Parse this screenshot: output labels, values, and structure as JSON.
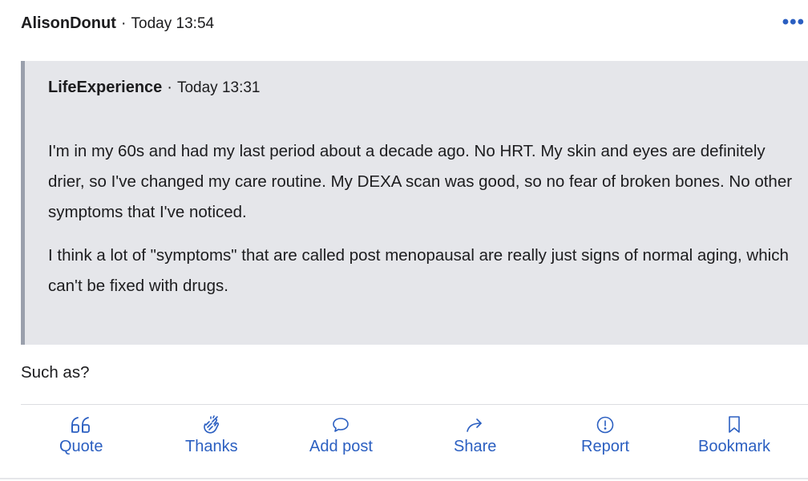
{
  "post": {
    "author": "AlisonDonut",
    "separator": "·",
    "time": "Today 13:54",
    "more_label": "•••",
    "quote": {
      "author": "LifeExperience",
      "separator": "·",
      "time": "Today 13:31",
      "paragraphs": [
        "I'm in my 60s and had my last period about a decade ago. No HRT. My skin and eyes are definitely drier, so I've changed my care routine. My DEXA scan was good, so no fear of broken bones. No other symptoms that I've noticed.",
        "I think a lot of \"symptoms\" that are called post menopausal are really just signs of normal aging, which can't be fixed with drugs."
      ]
    },
    "reply": "Such as?"
  },
  "actions": {
    "quote": {
      "label": "Quote",
      "icon": "quote-icon"
    },
    "thanks": {
      "label": "Thanks",
      "icon": "clapping-hands-icon"
    },
    "add_post": {
      "label": "Add post",
      "icon": "speech-bubble-icon"
    },
    "share": {
      "label": "Share",
      "icon": "share-arrow-icon"
    },
    "report": {
      "label": "Report",
      "icon": "exclamation-circle-icon"
    },
    "bookmark": {
      "label": "Bookmark",
      "icon": "bookmark-icon"
    }
  },
  "colors": {
    "accent": "#2b5fc1",
    "quote_background": "#e5e6ea",
    "quote_border": "#9aa0ac",
    "text": "#1c1c1e"
  }
}
